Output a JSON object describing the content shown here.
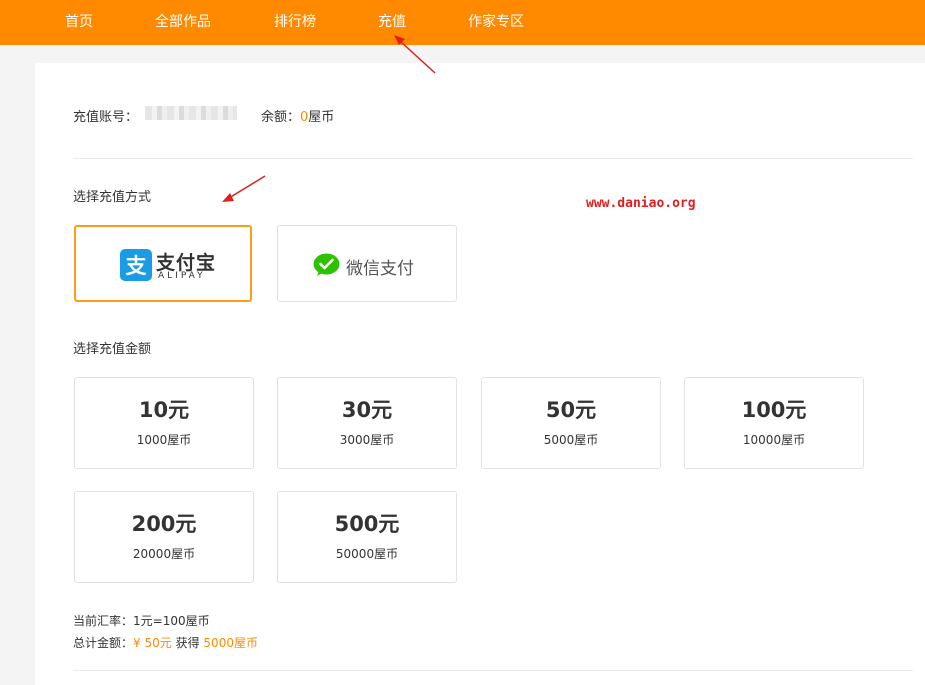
{
  "nav": {
    "items": [
      {
        "label": "首页"
      },
      {
        "label": "全部作品"
      },
      {
        "label": "排行榜"
      },
      {
        "label": "充值"
      },
      {
        "label": "作家专区"
      }
    ]
  },
  "account": {
    "label": "充值账号：",
    "balance_label": "余额：",
    "balance_value": "0",
    "balance_unit": "屋币"
  },
  "payment": {
    "section_title": "选择充值方式",
    "alipay": {
      "cn": "支付宝",
      "en": "ALIPAY"
    },
    "wechat": {
      "label": "微信支付"
    }
  },
  "watermark": "www.daniao.org",
  "amounts": {
    "section_title": "选择充值金额",
    "options": [
      {
        "yuan": "10元",
        "coins": "1000屋币"
      },
      {
        "yuan": "30元",
        "coins": "3000屋币"
      },
      {
        "yuan": "50元",
        "coins": "5000屋币"
      },
      {
        "yuan": "100元",
        "coins": "10000屋币"
      },
      {
        "yuan": "200元",
        "coins": "20000屋币"
      },
      {
        "yuan": "500元",
        "coins": "50000屋币"
      }
    ]
  },
  "summary": {
    "rate": "当前汇率：1元=100屋币",
    "total_label": "总计金额：",
    "total_value": "¥ 50元",
    "get_label": "获得",
    "get_value": "5000屋币"
  },
  "colors": {
    "brand": "#ff8a00",
    "alipay_blue": "#1a9be6",
    "wechat_green": "#2dc100",
    "annotation_red": "#e02020"
  }
}
